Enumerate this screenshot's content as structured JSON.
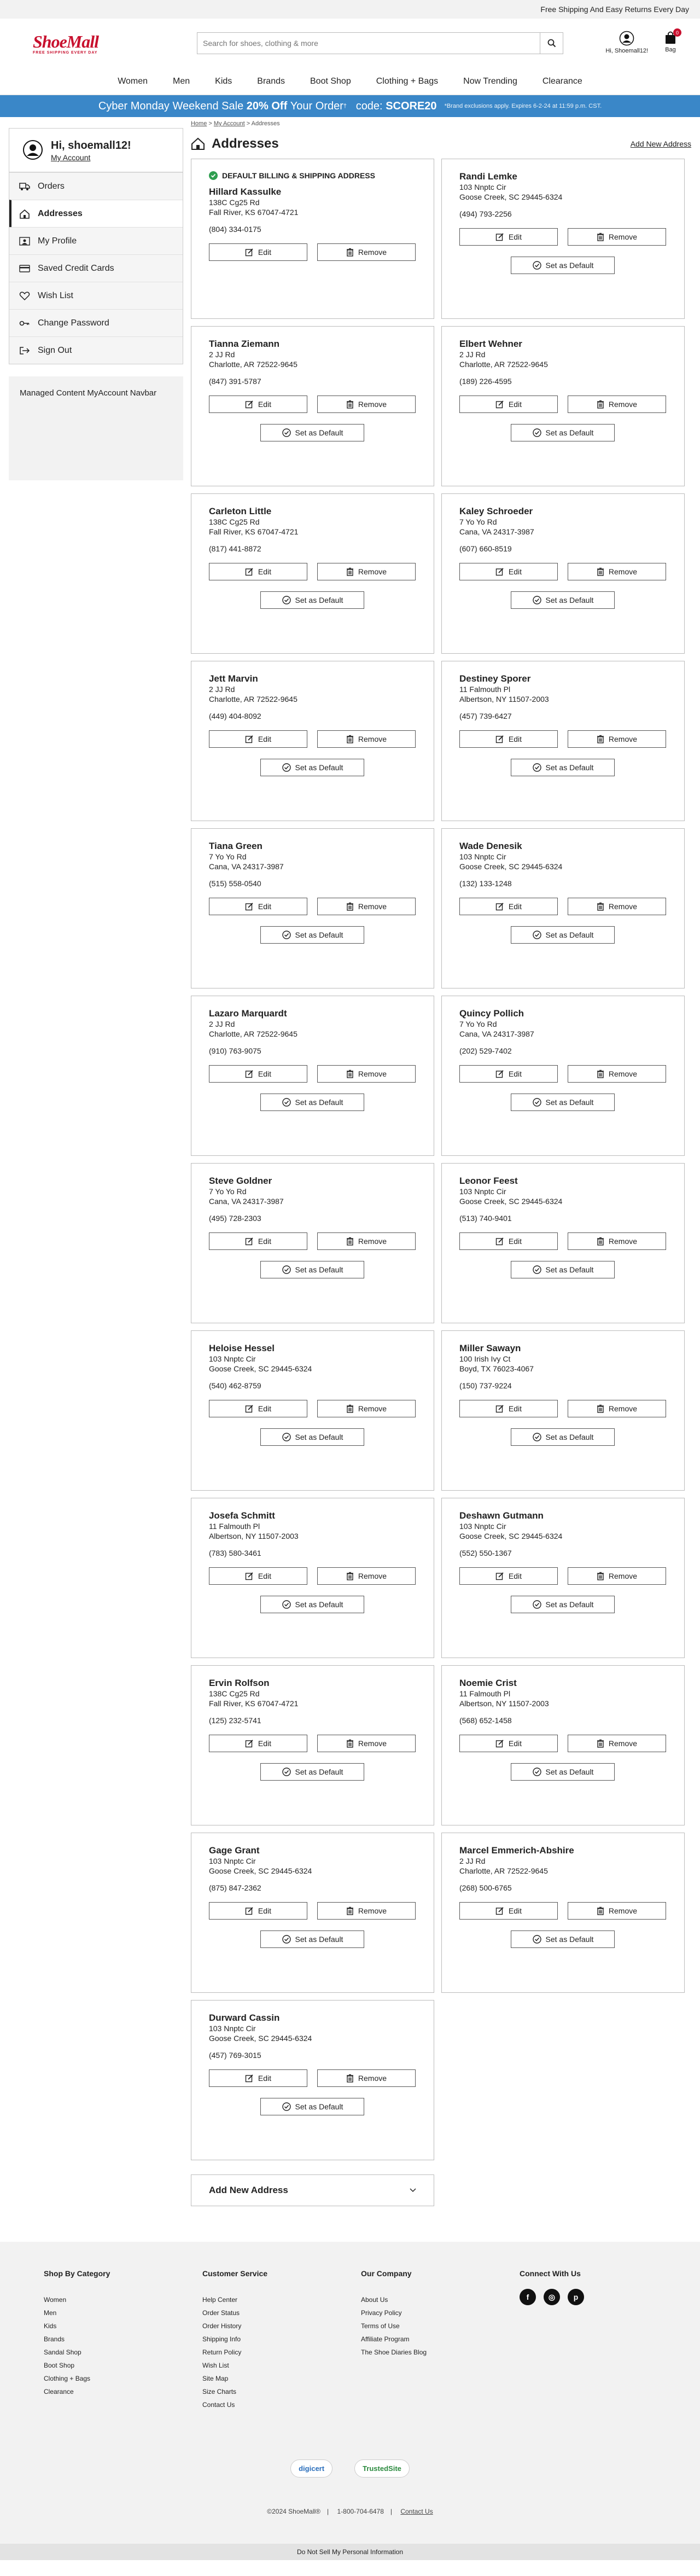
{
  "topbar": {
    "text": "Free Shipping And Easy Returns Every Day"
  },
  "header": {
    "logo": "ShoeMall",
    "logo_tagline": "FREE SHIPPING EVERY DAY",
    "search_placeholder": "Search for shoes, clothing & more",
    "account_label": "Hi, Shoemall12!",
    "bag_label": "Bag",
    "bag_count": "0"
  },
  "nav": [
    "Women",
    "Men",
    "Kids",
    "Brands",
    "Boot Shop",
    "Clothing + Bags",
    "Now Trending",
    "Clearance"
  ],
  "banner": {
    "lead": "Cyber Monday Weekend Sale",
    "offer": "20% Off",
    "tail": "Your Order",
    "dagger": "†",
    "code_label": "code:",
    "code": "SCORE20",
    "fine_print": "*Brand exclusions apply. Expires 6-2-24 at 11:59 p.m. CST."
  },
  "sidebar": {
    "greeting": "Hi, shoemall12!",
    "my_account": "My Account",
    "items": [
      "Orders",
      "Addresses",
      "My Profile",
      "Saved Credit Cards",
      "Wish List",
      "Change Password",
      "Sign Out"
    ],
    "managed_content": "Managed Content MyAccount Navbar"
  },
  "breadcrumb": {
    "home": "Home",
    "my_account": "My Account",
    "current": "Addresses"
  },
  "page": {
    "title": "Addresses",
    "add_link": "Add New Address"
  },
  "labels": {
    "default_flag": "DEFAULT BILLING & SHIPPING ADDRESS",
    "edit": "Edit",
    "remove": "Remove",
    "set_default": "Set as Default",
    "add_new_address": "Add New Address"
  },
  "addresses": [
    {
      "name": "Hillard Kassulke",
      "street": "138C Cg25 Rd",
      "city": "Fall River, KS 67047-4721",
      "phone": "(804) 334-0175",
      "is_default": true
    },
    {
      "name": "Randi Lemke",
      "street": "103 Nnptc Cir",
      "city": "Goose Creek, SC 29445-6324",
      "phone": "(494) 793-2256",
      "is_default": false
    },
    {
      "name": "Tianna Ziemann",
      "street": "2 JJ Rd",
      "city": "Charlotte, AR 72522-9645",
      "phone": "(847) 391-5787",
      "is_default": false
    },
    {
      "name": "Elbert Wehner",
      "street": "2 JJ Rd",
      "city": "Charlotte, AR 72522-9645",
      "phone": "(189) 226-4595",
      "is_default": false
    },
    {
      "name": "Carleton Little",
      "street": "138C Cg25 Rd",
      "city": "Fall River, KS 67047-4721",
      "phone": "(817) 441-8872",
      "is_default": false
    },
    {
      "name": "Kaley Schroeder",
      "street": "7 Yo Yo Rd",
      "city": "Cana, VA 24317-3987",
      "phone": "(607) 660-8519",
      "is_default": false
    },
    {
      "name": "Jett Marvin",
      "street": "2 JJ Rd",
      "city": "Charlotte, AR 72522-9645",
      "phone": "(449) 404-8092",
      "is_default": false
    },
    {
      "name": "Destiney Sporer",
      "street": "11 Falmouth Pl",
      "city": "Albertson, NY 11507-2003",
      "phone": "(457) 739-6427",
      "is_default": false
    },
    {
      "name": "Tiana Green",
      "street": "7 Yo Yo Rd",
      "city": "Cana, VA 24317-3987",
      "phone": "(515) 558-0540",
      "is_default": false
    },
    {
      "name": "Wade Denesik",
      "street": "103 Nnptc Cir",
      "city": "Goose Creek, SC 29445-6324",
      "phone": "(132) 133-1248",
      "is_default": false
    },
    {
      "name": "Lazaro Marquardt",
      "street": "2 JJ Rd",
      "city": "Charlotte, AR 72522-9645",
      "phone": "(910) 763-9075",
      "is_default": false
    },
    {
      "name": "Quincy Pollich",
      "street": "7 Yo Yo Rd",
      "city": "Cana, VA 24317-3987",
      "phone": "(202) 529-7402",
      "is_default": false
    },
    {
      "name": "Steve Goldner",
      "street": "7 Yo Yo Rd",
      "city": "Cana, VA 24317-3987",
      "phone": "(495) 728-2303",
      "is_default": false
    },
    {
      "name": "Leonor Feest",
      "street": "103 Nnptc Cir",
      "city": "Goose Creek, SC 29445-6324",
      "phone": "(513) 740-9401",
      "is_default": false
    },
    {
      "name": "Heloise Hessel",
      "street": "103 Nnptc Cir",
      "city": "Goose Creek, SC 29445-6324",
      "phone": "(540) 462-8759",
      "is_default": false
    },
    {
      "name": "Miller Sawayn",
      "street": "100 Irish Ivy Ct",
      "city": "Boyd, TX 76023-4067",
      "phone": "(150) 737-9224",
      "is_default": false
    },
    {
      "name": "Josefa Schmitt",
      "street": "11 Falmouth Pl",
      "city": "Albertson, NY 11507-2003",
      "phone": "(783) 580-3461",
      "is_default": false
    },
    {
      "name": "Deshawn Gutmann",
      "street": "103 Nnptc Cir",
      "city": "Goose Creek, SC 29445-6324",
      "phone": "(552) 550-1367",
      "is_default": false
    },
    {
      "name": "Ervin Rolfson",
      "street": "138C Cg25 Rd",
      "city": "Fall River, KS 67047-4721",
      "phone": "(125) 232-5741",
      "is_default": false
    },
    {
      "name": "Noemie Crist",
      "street": "11 Falmouth Pl",
      "city": "Albertson, NY 11507-2003",
      "phone": "(568) 652-1458",
      "is_default": false
    },
    {
      "name": "Gage Grant",
      "street": "103 Nnptc Cir",
      "city": "Goose Creek, SC 29445-6324",
      "phone": "(875) 847-2362",
      "is_default": false
    },
    {
      "name": "Marcel Emmerich-Abshire",
      "street": "2 JJ Rd",
      "city": "Charlotte, AR 72522-9645",
      "phone": "(268) 500-6765",
      "is_default": false
    },
    {
      "name": "Durward Cassin",
      "street": "103 Nnptc Cir",
      "city": "Goose Creek, SC 29445-6324",
      "phone": "(457) 769-3015",
      "is_default": false
    }
  ],
  "footer": {
    "columns": [
      {
        "title": "Shop By Category",
        "links": [
          "Women",
          "Men",
          "Kids",
          "Brands",
          "Sandal Shop",
          "Boot Shop",
          "Clothing + Bags",
          "Clearance"
        ]
      },
      {
        "title": "Customer Service",
        "links": [
          "Help Center",
          "Order Status",
          "Order History",
          "Shipping Info",
          "Return Policy",
          "Wish List",
          "Site Map",
          "Size Charts",
          "Contact Us"
        ]
      },
      {
        "title": "Our Company",
        "links": [
          "About Us",
          "Privacy Policy",
          "Terms of Use",
          "Affiliate Program",
          "The Shoe Diaries Blog"
        ]
      }
    ],
    "connect_title": "Connect With Us",
    "seal_digicert": "digicert",
    "seal_trustedsite": "TrustedSite",
    "copyright": "©2024 ShoeMall®",
    "phone": "1-800-704-6478",
    "contact": "Contact Us",
    "do_not_sell": "Do Not Sell My Personal Information"
  }
}
